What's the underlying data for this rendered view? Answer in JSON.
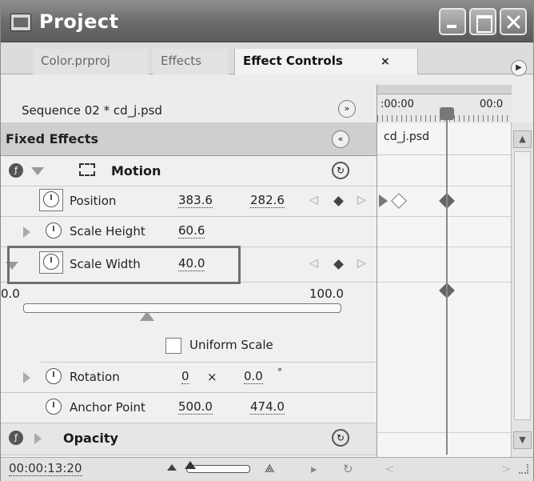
{
  "window": {
    "title": "Project",
    "icons": {
      "app": "project-window-icon",
      "minimize": "minimize-icon",
      "maximize": "maximize-icon",
      "close": "close-icon"
    }
  },
  "tabs": [
    {
      "label": "Color.prproj",
      "active": false
    },
    {
      "label": "Effects",
      "active": false
    },
    {
      "label": "Effect Controls",
      "active": true
    }
  ],
  "tab_close_glyph": "×",
  "sequence": {
    "label": "Sequence 02 * cd_j.psd",
    "toggle_glyph": "»"
  },
  "timeline": {
    "start_time": ":00:00",
    "end_time": "00:0",
    "clip_label": "cd_j.psd"
  },
  "fixed_effects": {
    "title": "Fixed Effects",
    "collapse_glyph": "«"
  },
  "motion": {
    "label": "Motion",
    "position": {
      "label": "Position",
      "x": "383.6",
      "y": "282.6"
    },
    "scale_height": {
      "label": "Scale Height",
      "value": "60.6"
    },
    "scale_width": {
      "label": "Scale Width",
      "value": "40.0"
    },
    "scale_slider": {
      "min_label": "0.0",
      "max_label": "100.0",
      "value_percent": 40
    },
    "uniform_scale": {
      "label": "Uniform Scale",
      "checked": false
    },
    "rotation": {
      "label": "Rotation",
      "turns": "0",
      "separator": "×",
      "degrees": "0.0",
      "degree_mark": "°"
    },
    "anchor_point": {
      "label": "Anchor Point",
      "x": "500.0",
      "y": "474.0"
    }
  },
  "opacity": {
    "label": "Opacity"
  },
  "bottom": {
    "timecode": "00:00:13:20"
  },
  "glyphs": {
    "kf_prev": "◁",
    "kf_next": "▷",
    "reset": "↻",
    "fx": "ƒ",
    "scroll_up": "▲",
    "scroll_down": "▼",
    "panel_menu": "▶",
    "zoom_out": "▵",
    "zoom_in": "⟁",
    "play_audio": "▸",
    "loop": "↻",
    "scroll_prev": "<",
    "scroll_next": ">"
  }
}
